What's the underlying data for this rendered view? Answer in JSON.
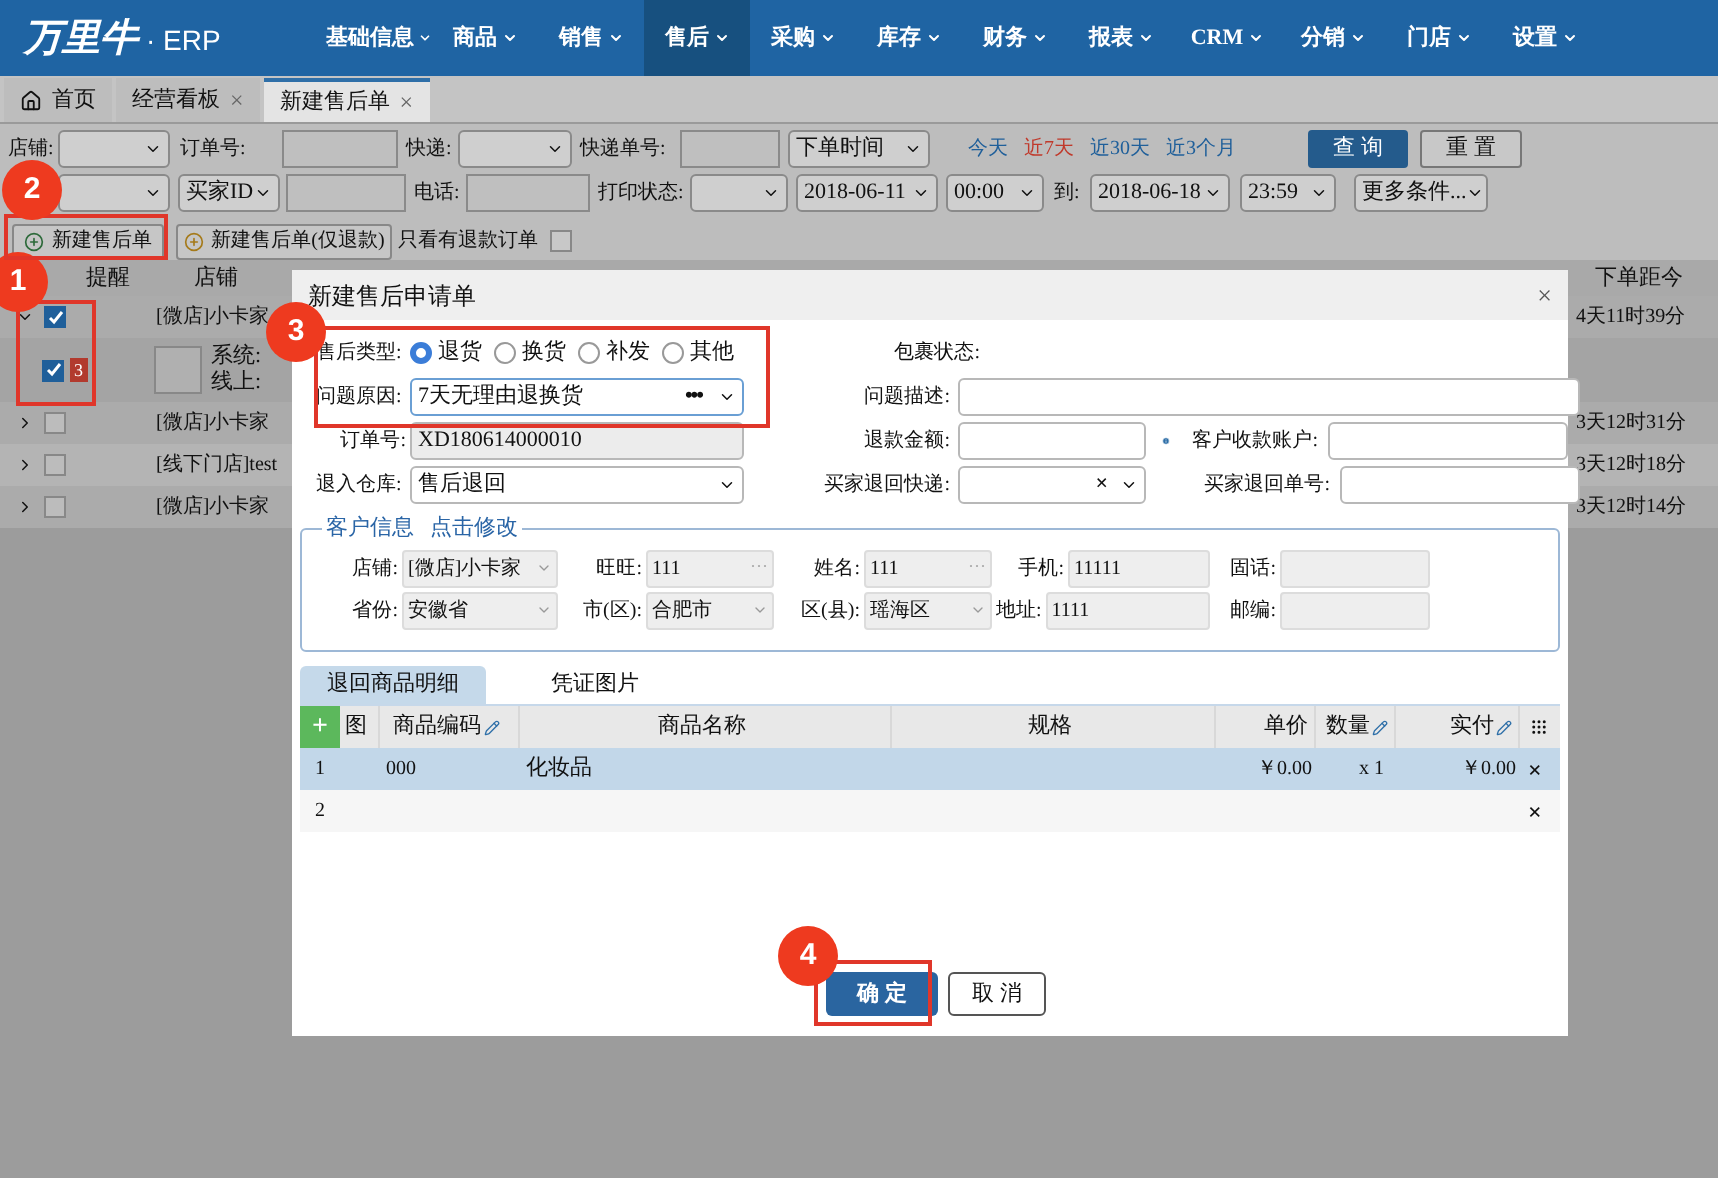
{
  "nav": {
    "logo": "万里牛",
    "suffix": "· ERP",
    "items": [
      {
        "label": "基础信息",
        "selected": false
      },
      {
        "label": "商品",
        "selected": false
      },
      {
        "label": "销售",
        "selected": false
      },
      {
        "label": "售后",
        "selected": true
      },
      {
        "label": "采购",
        "selected": false
      },
      {
        "label": "库存",
        "selected": false
      },
      {
        "label": "财务",
        "selected": false
      },
      {
        "label": "报表",
        "selected": false
      },
      {
        "label": "CRM",
        "selected": false
      },
      {
        "label": "分销",
        "selected": false
      },
      {
        "label": "门店",
        "selected": false
      },
      {
        "label": "设置",
        "selected": false
      }
    ]
  },
  "tabs": [
    {
      "label": "首页",
      "kind": "home",
      "selected": false
    },
    {
      "label": "经营看板",
      "kind": "closable",
      "close": "×",
      "selected": false
    },
    {
      "label": "新建售后单",
      "kind": "closable",
      "close": "×",
      "selected": true
    }
  ],
  "filters": {
    "store_label": "店铺:",
    "order_label": "订单号:",
    "express_label": "快递:",
    "express_no_label": "快递单号:",
    "time_type": "下单时间",
    "quick_ranges": [
      {
        "label": "今天",
        "selected": false
      },
      {
        "label": "近7天",
        "selected": true
      },
      {
        "label": "近30天",
        "selected": false
      },
      {
        "label": "近3个月",
        "selected": false
      }
    ],
    "search_button": "查 询",
    "reset_button": "重 置",
    "buyer_type": "买家ID",
    "phone_label": "电话:",
    "print_label": "打印状态:",
    "date_from": "2018-06-11",
    "time_from": "00:00",
    "to_label": "到:",
    "date_to": "2018-06-18",
    "time_to": "23:59",
    "more_button": "更多条件...",
    "new_button": "新建售后单",
    "new_refund_button": "新建售后单(仅退款)",
    "refund_only_label": "只看有退款订单",
    "refund_only_checked": false
  },
  "table": {
    "columns": [
      "提醒",
      "店铺"
    ],
    "last_column": "下单距今",
    "rows": [
      {
        "kind": "order",
        "expanded": true,
        "checked": true,
        "store": "[微店]小卡家",
        "age": "4天11时39分"
      },
      {
        "kind": "detail",
        "checked": true,
        "badge": "3",
        "lines": [
          "系统:",
          "线上:"
        ]
      },
      {
        "kind": "order",
        "expanded": false,
        "checked": false,
        "store": "[微店]小卡家",
        "age": "3天12时31分"
      },
      {
        "kind": "order",
        "expanded": false,
        "checked": false,
        "store": "[线下门店]test",
        "age": "3天12时18分"
      },
      {
        "kind": "order",
        "expanded": false,
        "checked": false,
        "store": "[微店]小卡家",
        "age": "3天12时14分"
      }
    ]
  },
  "dialog": {
    "title": "新建售后申请单",
    "close": "×",
    "type_label": "售后类型:",
    "types": [
      {
        "label": "退货",
        "selected": true
      },
      {
        "label": "换货",
        "selected": false
      },
      {
        "label": "补发",
        "selected": false
      },
      {
        "label": "其他",
        "selected": false
      }
    ],
    "reason_label": "问题原因:",
    "reason": "7天无理由退换货",
    "more": "•••",
    "order_label": "订单号:",
    "order_no": "XD180614000010",
    "warehouse_label": "退入仓库:",
    "warehouse": "售后退回",
    "package_label": "包裹状态:",
    "desc_label": "问题描述:",
    "amount_label": "退款金额:",
    "account_label": "客户收款账户:",
    "express_label": "买家退回快递:",
    "express_clear": "×",
    "return_no_label": "买家退回单号:",
    "customer": {
      "legend": "客户信息",
      "edit_link": "点击修改",
      "fields": [
        {
          "label": "店铺:",
          "value": "[微店]小卡家",
          "kind": "select"
        },
        {
          "label": "旺旺:",
          "value": "111",
          "kind": "more",
          "more": "···"
        },
        {
          "label": "姓名:",
          "value": "111",
          "kind": "more",
          "more": "···"
        },
        {
          "label": "手机:",
          "value": "11111",
          "kind": "text"
        },
        {
          "label": "固话:",
          "kind": "text"
        },
        {
          "label": "省份:",
          "value": "安徽省",
          "kind": "select"
        },
        {
          "label": "市(区):",
          "value": "合肥市",
          "kind": "select"
        },
        {
          "label": "区(县):",
          "value": "瑶海区",
          "kind": "select"
        },
        {
          "label": "地址:",
          "value": "1111",
          "kind": "text"
        },
        {
          "label": "邮编:",
          "kind": "text"
        }
      ]
    },
    "detail_tabs": [
      {
        "label": "退回商品明细",
        "selected": true
      },
      {
        "label": "凭证图片",
        "selected": false
      }
    ],
    "items": {
      "add": "+",
      "columns": [
        {
          "label": "图",
          "editable": false
        },
        {
          "label": "商品编码",
          "editable": true
        },
        {
          "label": "商品名称",
          "editable": false
        },
        {
          "label": "规格",
          "editable": false
        },
        {
          "label": "单价",
          "editable": false
        },
        {
          "label": "数量",
          "editable": true
        },
        {
          "label": "实付",
          "editable": true
        }
      ],
      "rows": [
        {
          "no": "1",
          "code": "000",
          "name": "化妆品",
          "price": "￥0.00",
          "qty": "x 1",
          "paid": "￥0.00",
          "remove": "×",
          "selected": true
        },
        {
          "no": "2",
          "remove": "×",
          "selected": false
        }
      ]
    },
    "ok_button": "确 定",
    "cancel_button": "取 消"
  },
  "annotations": [
    {
      "label": "1"
    },
    {
      "label": "2"
    },
    {
      "label": "3"
    },
    {
      "label": "4"
    }
  ]
}
